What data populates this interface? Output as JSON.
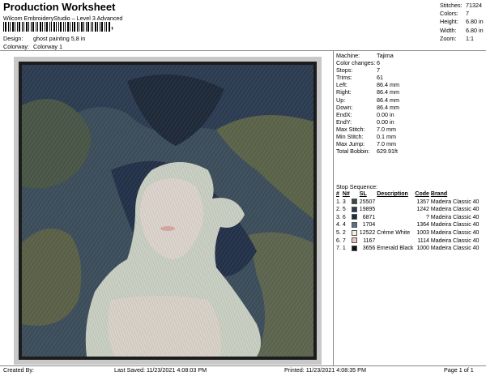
{
  "header": {
    "title": "Production Worksheet",
    "subtitle": "Wilcom EmbroideryStudio – Level 3 Advanced",
    "barcode_suffix": ","
  },
  "info": {
    "design_label": "Design:",
    "design_value": "ghost painting 5,8 in",
    "colorway_label": "Colorway:",
    "colorway_value": "Colorway 1"
  },
  "stats": [
    {
      "label": "Stitches:",
      "value": "71324"
    },
    {
      "label": "Colors:",
      "value": "7"
    },
    {
      "label": "Height:",
      "value": "6.80 in"
    },
    {
      "label": "Width:",
      "value": "6.80 in"
    },
    {
      "label": "Zoom:",
      "value": "1:1"
    }
  ],
  "machine_params": [
    {
      "label": "Machine:",
      "value": "Tajima"
    },
    {
      "label": "Color changes:",
      "value": "6"
    },
    {
      "label": "Stops:",
      "value": "7"
    },
    {
      "label": "Trims:",
      "value": "61"
    },
    {
      "label": "Left:",
      "value": "86.4 mm"
    },
    {
      "label": "Right:",
      "value": "86.4 mm"
    },
    {
      "label": "Up:",
      "value": "86.4 mm"
    },
    {
      "label": "Down:",
      "value": "86.4 mm"
    },
    {
      "label": "EndX:",
      "value": "0.00 in"
    },
    {
      "label": "EndY:",
      "value": "0.00 in"
    },
    {
      "label": "Max Stitch:",
      "value": "7.0 mm"
    },
    {
      "label": "Min Stitch:",
      "value": "0.1 mm"
    },
    {
      "label": "Max Jump:",
      "value": "7.0 mm"
    },
    {
      "label": "Total Bobbin:",
      "value": "629.91ft"
    }
  ],
  "stop_sequence": {
    "title": "Stop Sequence:",
    "headers": {
      "num": "#",
      "n": "N#",
      "sl": "SL",
      "desc": "Description",
      "code": "Code",
      "brand": "Brand"
    },
    "rows": [
      {
        "num": "1.",
        "n": "3",
        "color": "#3b4a3e",
        "sl": "25507",
        "desc": "",
        "code": "1357",
        "brand": "Madeira Classic 40"
      },
      {
        "num": "2.",
        "n": "5",
        "color": "#2b3a52",
        "sl": "19895",
        "desc": "",
        "code": "1242",
        "brand": "Madeira Classic 40"
      },
      {
        "num": "3.",
        "n": "6",
        "color": "#1f2a3a",
        "sl": "6871",
        "desc": "",
        "code": "?",
        "brand": "Madeira Classic 40"
      },
      {
        "num": "4.",
        "n": "4",
        "color": "#5a6f88",
        "sl": "1704",
        "desc": "",
        "code": "1364",
        "brand": "Madeira Classic 40"
      },
      {
        "num": "5.",
        "n": "2",
        "color": "#eef0e8",
        "sl": "12522",
        "desc": "Crème White",
        "code": "1003",
        "brand": "Madeira Classic 40"
      },
      {
        "num": "6.",
        "n": "7",
        "color": "#e8c6c0",
        "sl": "1167",
        "desc": "",
        "code": "1114",
        "brand": "Madeira Classic 40"
      },
      {
        "num": "7.",
        "n": "1",
        "color": "#111111",
        "sl": "3656",
        "desc": "Emerald Black",
        "code": "1000",
        "brand": "Madeira Classic 40"
      }
    ]
  },
  "footer": {
    "created_by": "Created By:",
    "last_saved": "Last Saved: 11/23/2021 4:08:03 PM",
    "printed": "Printed: 11/23/2021 4:08:35 PM",
    "page": "Page 1 of 1"
  },
  "colors": {
    "rule": "#888888",
    "frame_bg": "#c8c8c8",
    "border": "#222222"
  }
}
